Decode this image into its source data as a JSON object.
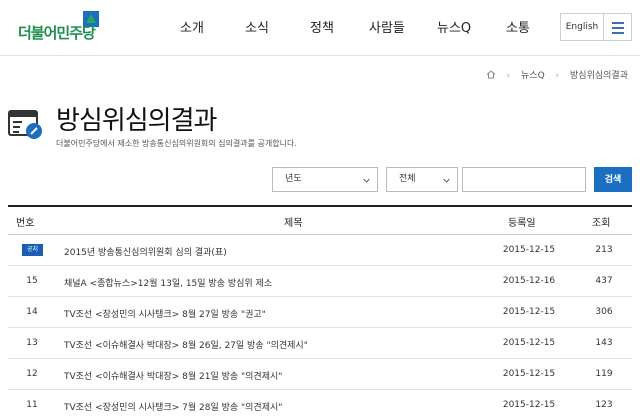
{
  "header": {
    "logo_text": "더불어민주당",
    "nav": [
      "소개",
      "소식",
      "정책",
      "사람들",
      "뉴스Q",
      "소통"
    ],
    "lang_label": "English"
  },
  "breadcrumb": [
    "뉴스Q",
    "방심위심의결과"
  ],
  "page": {
    "title": "방심위심의결과",
    "description": "더불어민주당에서 제소한 방송통신심의위원회의 심의결과를 공개합니다."
  },
  "search": {
    "year_select": "년도",
    "scope_select": "전체",
    "query": "",
    "button_label": "검색"
  },
  "table": {
    "headers": [
      "번호",
      "제목",
      "등록일",
      "조회"
    ],
    "rows": [
      {
        "no": "",
        "badge": "공지",
        "title": "2015년 방송통신심의위원회 심의 결과(표)",
        "date": "2015-12-15",
        "views": "213"
      },
      {
        "no": "15",
        "badge": "",
        "title": "채널A <종합뉴스>12월 13일, 15일 방송 방심위 제소",
        "date": "2015-12-16",
        "views": "437"
      },
      {
        "no": "14",
        "badge": "",
        "title": "TV조선 <장성민의 시사탱크> 8월 27일 방송 \"권고\"",
        "date": "2015-12-15",
        "views": "306"
      },
      {
        "no": "13",
        "badge": "",
        "title": "TV조선 <이슈해결사 박대장> 8월 26일, 27일 방송 \"의견제시\"",
        "date": "2015-12-15",
        "views": "143"
      },
      {
        "no": "12",
        "badge": "",
        "title": "TV조선 <이슈해결사 박대장> 8월 21일 방송 \"의견제시\"",
        "date": "2015-12-15",
        "views": "119"
      },
      {
        "no": "11",
        "badge": "",
        "title": "TV조선 <장성민의 시사탱크> 7월 28일 방송 \"의견제시\"",
        "date": "2015-12-15",
        "views": "123"
      }
    ]
  },
  "colors": {
    "brand_green": "#1f8f4e",
    "accent_blue": "#1a6fc1",
    "badge_blue": "#1a5fb4"
  },
  "icons": [
    "home-icon",
    "board-icon",
    "menu-icon",
    "chevron-down-icon"
  ]
}
